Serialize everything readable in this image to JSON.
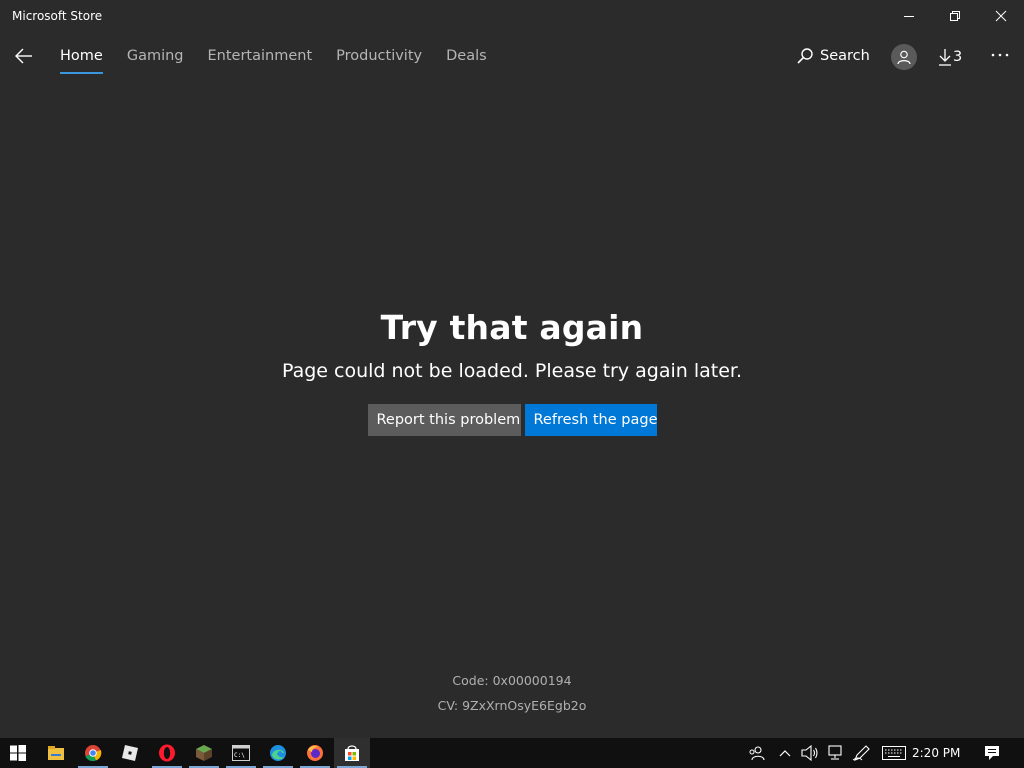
{
  "window": {
    "title": "Microsoft Store",
    "controls": [
      "minimize",
      "restore",
      "close"
    ]
  },
  "nav": {
    "tabs": [
      {
        "label": "Home",
        "active": true
      },
      {
        "label": "Gaming",
        "active": false
      },
      {
        "label": "Entertainment",
        "active": false
      },
      {
        "label": "Productivity",
        "active": false
      },
      {
        "label": "Deals",
        "active": false
      }
    ],
    "search_label": "Search",
    "downloads_count": "3",
    "accent_color": "#3a96dd"
  },
  "error": {
    "title": "Try that again",
    "message": "Page could not be loaded. Please try again later.",
    "report_button": "Report this problem",
    "refresh_button": "Refresh the page",
    "code": "Code: 0x00000194",
    "cv": "CV: 9ZxXrnOsyE6Egb2o"
  },
  "taskbar": {
    "apps": [
      {
        "name": "file-explorer-icon",
        "open": false
      },
      {
        "name": "chrome-icon",
        "open": true
      },
      {
        "name": "roblox-icon",
        "open": false
      },
      {
        "name": "opera-icon",
        "open": true
      },
      {
        "name": "minecraft-icon",
        "open": true
      },
      {
        "name": "command-prompt-icon",
        "open": true
      },
      {
        "name": "edge-icon",
        "open": true
      },
      {
        "name": "firefox-icon",
        "open": true
      },
      {
        "name": "store-icon",
        "open": true,
        "active": true
      }
    ],
    "clock": "2:20 PM"
  }
}
